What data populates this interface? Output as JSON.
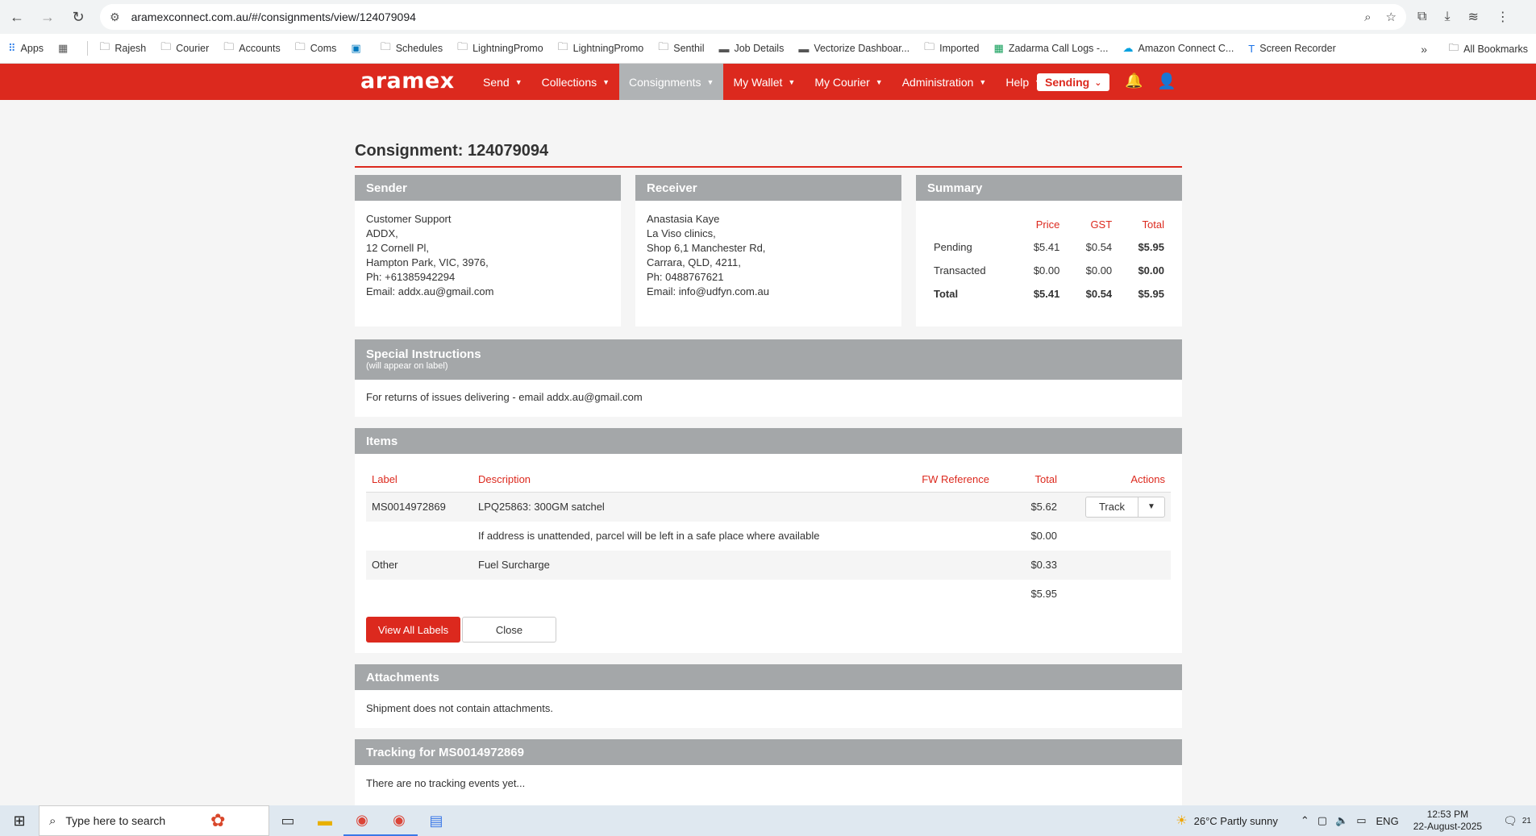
{
  "browser": {
    "url": "aramexconnect.com.au/#/consignments/view/124079094",
    "bookmarks": [
      "Apps",
      "Rajesh",
      "Courier",
      "Accounts",
      "Coms",
      "Schedules",
      "LightningPromo",
      "LightningPromo",
      "Senthil",
      "Job Details",
      "Vectorize Dashboar...",
      "Imported",
      "Zadarma Call Logs -...",
      "Amazon Connect C...",
      "Screen Recorder"
    ],
    "all_bookmarks": "All Bookmarks"
  },
  "nav": {
    "logo": "aramex",
    "menu": [
      "Send",
      "Collections",
      "Consignments",
      "My Wallet",
      "My Courier",
      "Administration",
      "Help"
    ],
    "sending": "Sending"
  },
  "page": {
    "title": "Consignment: 124079094"
  },
  "sender": {
    "heading": "Sender",
    "lines": [
      "Customer Support",
      "ADDX,",
      "12 Cornell Pl,",
      "Hampton Park, VIC, 3976,",
      "Ph: +61385942294",
      "Email: addx.au@gmail.com"
    ]
  },
  "receiver": {
    "heading": "Receiver",
    "lines": [
      "Anastasia Kaye",
      "La Viso clinics,",
      "Shop 6,1 Manchester Rd,",
      "Carrara, QLD, 4211,",
      "Ph: 0488767621",
      "Email: info@udfyn.com.au"
    ]
  },
  "summary": {
    "heading": "Summary",
    "columns": [
      "Price",
      "GST",
      "Total"
    ],
    "rows": [
      {
        "label": "Pending",
        "price": "$5.41",
        "gst": "$0.54",
        "total": "$5.95"
      },
      {
        "label": "Transacted",
        "price": "$0.00",
        "gst": "$0.00",
        "total": "$0.00"
      },
      {
        "label": "Total",
        "price": "$5.41",
        "gst": "$0.54",
        "total": "$5.95"
      }
    ]
  },
  "special": {
    "heading": "Special Instructions",
    "subheading": "(will appear on label)",
    "text": "For returns of issues delivering - email addx.au@gmail.com"
  },
  "items": {
    "heading": "Items",
    "columns": [
      "Label",
      "Description",
      "FW Reference",
      "Total",
      "Actions"
    ],
    "rows": [
      {
        "label": "MS0014972869",
        "description": "LPQ25863: 300GM satchel",
        "fw": "",
        "total": "$5.62",
        "action": "Track"
      },
      {
        "label": "",
        "description": "If address is unattended, parcel will be left in a safe place where available",
        "fw": "",
        "total": "$0.00"
      },
      {
        "label": "Other",
        "description": "Fuel Surcharge",
        "fw": "",
        "total": "$0.33"
      },
      {
        "label": "",
        "description": "",
        "fw": "",
        "total": "$5.95"
      }
    ],
    "view_all_labels": "View All Labels",
    "close": "Close"
  },
  "attachments": {
    "heading": "Attachments",
    "text": "Shipment does not contain attachments."
  },
  "tracking": {
    "heading": "Tracking for MS0014972869",
    "text": "There are no tracking events yet..."
  },
  "taskbar": {
    "search_placeholder": "Type here to search",
    "weather": "26°C  Partly sunny",
    "lang": "ENG",
    "time": "12:53 PM",
    "date": "22-August-2025",
    "notifications": "21"
  }
}
